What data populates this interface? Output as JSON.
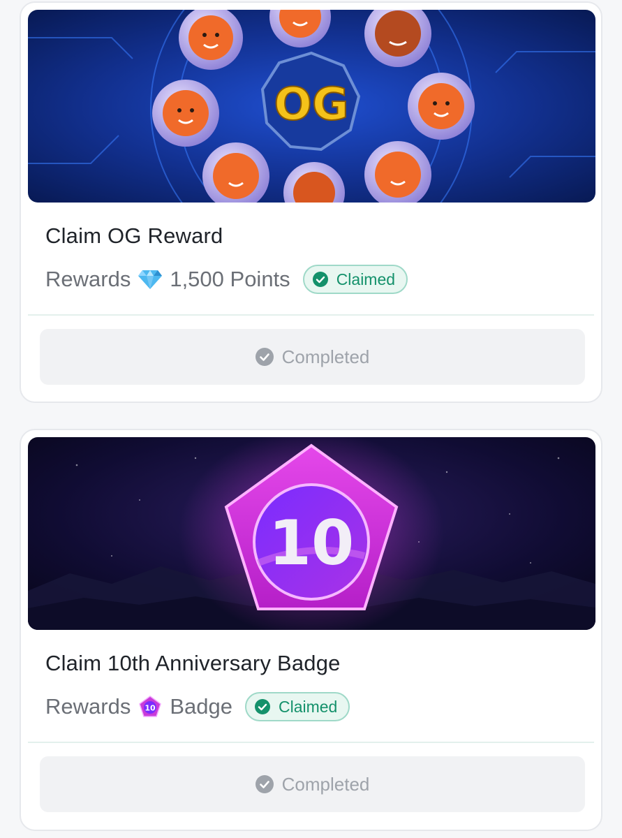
{
  "cards": [
    {
      "title": "Claim OG Reward",
      "banner_text": "OG",
      "rewards_label": "Rewards",
      "reward_icon": "gem-icon",
      "reward_value": "1,500 Points",
      "status_label": "Claimed",
      "button_label": "Completed"
    },
    {
      "title": "Claim 10th Anniversary Badge",
      "banner_text": "10",
      "rewards_label": "Rewards",
      "reward_icon": "anniversary-badge-icon",
      "reward_value": "Badge",
      "status_label": "Claimed",
      "button_label": "Completed"
    }
  ],
  "colors": {
    "claimed_green": "#14916b",
    "claimed_bg": "#e8f7f1",
    "completed_gray": "#9ea3aa",
    "og_banner_bg": "#0c2a7a",
    "badge_banner_bg": "#0b0a2a",
    "badge_magenta": "#e23ce8"
  }
}
